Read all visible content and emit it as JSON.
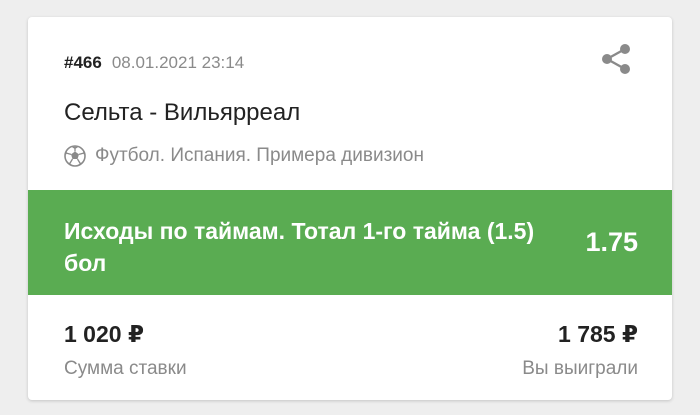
{
  "bet": {
    "id": "#466",
    "datetime": "08.01.2021 23:14",
    "match": "Сельта - Вильярреал",
    "league": "Футбол. Испания. Примера дивизион",
    "outcome": "Исходы по таймам. Тотал 1-го тайма (1.5) бол",
    "odds": "1.75",
    "stake_amount": "1 020 ₽",
    "stake_label": "Сумма ставки",
    "win_amount": "1 785 ₽",
    "win_label": "Вы выиграли"
  },
  "icons": {
    "share": "share-icon",
    "sport": "soccer-ball-icon"
  },
  "colors": {
    "accent": "#5aac52",
    "muted": "#8a8a8a",
    "text": "#222222"
  }
}
